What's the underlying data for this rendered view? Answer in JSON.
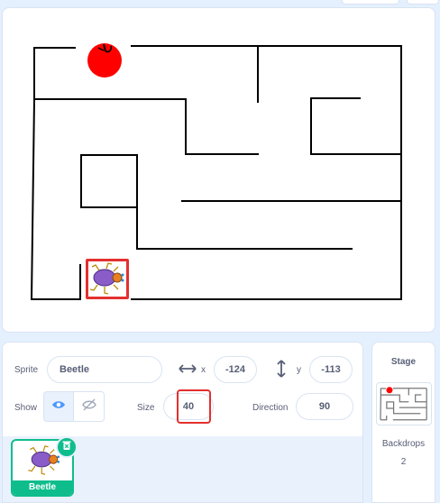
{
  "stage": {
    "sprites": [
      "apple",
      "beetle"
    ]
  },
  "sprite_info": {
    "sprite_label": "Sprite",
    "sprite_name": "Beetle",
    "x_label": "x",
    "x_value": "-124",
    "y_label": "y",
    "y_value": "-113",
    "show_label": "Show",
    "size_label": "Size",
    "size_value": "40",
    "direction_label": "Direction",
    "direction_value": "90"
  },
  "sprite_list": {
    "items": [
      {
        "name": "Beetle",
        "selected": true
      }
    ]
  },
  "stage_panel": {
    "title": "Stage",
    "backdrops_label": "Backdrops",
    "backdrops_count": "2"
  },
  "colors": {
    "accent": "#4c97ff",
    "selected": "#0fbd8c",
    "highlight": "#e3302f",
    "background": "#e5f0ff"
  }
}
